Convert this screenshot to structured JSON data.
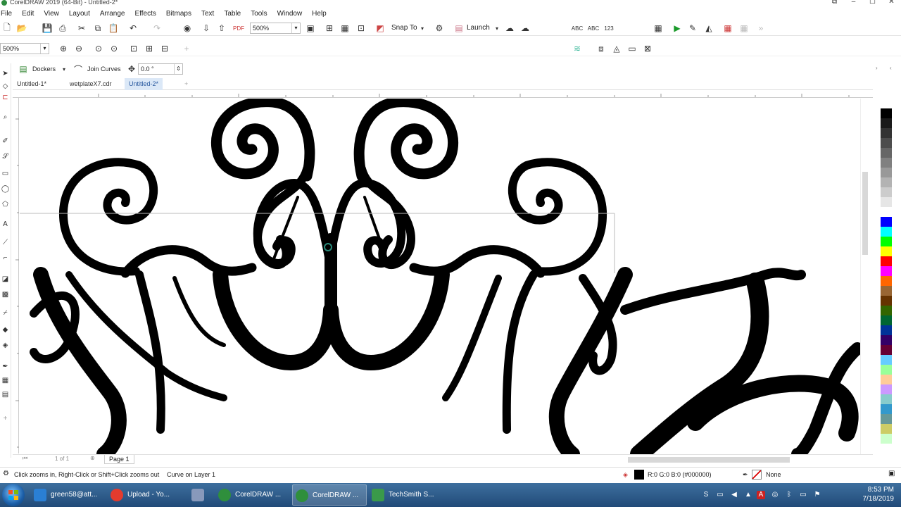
{
  "window": {
    "title": "CorelDRAW 2019 (64-Bit) - Untitled-2*"
  },
  "menu": [
    "File",
    "Edit",
    "View",
    "Layout",
    "Arrange",
    "Effects",
    "Bitmaps",
    "Text",
    "Table",
    "Tools",
    "Window",
    "Help"
  ],
  "toolbar": {
    "zoom_level": "500%",
    "snap_to": "Snap To",
    "launch": "Launch"
  },
  "toolbar2": {
    "zoom_level": "500%"
  },
  "property_bar": {
    "dockers": "Dockers",
    "join_curves": "Join Curves",
    "angle": "0.0 °"
  },
  "doc_tabs": [
    {
      "label": "Untitled-1*",
      "active": false
    },
    {
      "label": "wetplateX7.cdr",
      "active": false
    },
    {
      "label": "Untitled-2*",
      "active": true
    }
  ],
  "page_nav": {
    "page_label": "Page 1",
    "count": "1 of 1"
  },
  "status": {
    "hint": "Click zooms in, Right-Click or Shift+Click zooms out",
    "object": "Curve on Layer 1",
    "fill_color": "R:0 G:0 B:0 (#000000)",
    "outline": "None"
  },
  "palette_colors": [
    "#ffffff",
    "#000000",
    "#1a1a1a",
    "#333333",
    "#4d4d4d",
    "#666666",
    "#808080",
    "#999999",
    "#b3b3b3",
    "#cccccc",
    "#e6e6e6",
    "#ffffff",
    "#0000ff",
    "#00ffff",
    "#00ff00",
    "#ffff00",
    "#ff0000",
    "#ff00ff",
    "#ff6600",
    "#996633",
    "#663300",
    "#336600",
    "#006633",
    "#003399",
    "#330066",
    "#660033",
    "#66ccff",
    "#99ff99",
    "#ffcc99",
    "#cc99ff",
    "#88cccc",
    "#3399cc",
    "#669999",
    "#cccc66",
    "#ccffcc"
  ],
  "taskbar": {
    "items": [
      {
        "label": "green58@att...",
        "color": "#2a7fd4"
      },
      {
        "label": "Upload - Yo...",
        "color": "#e33b2e"
      },
      {
        "label": "",
        "color": "#8899bb"
      },
      {
        "label": "CorelDRAW ...",
        "color": "#2f8f3c"
      },
      {
        "label": "CorelDRAW ...",
        "color": "#2f8f3c"
      },
      {
        "label": "TechSmith S...",
        "color": "#3a9a4a"
      }
    ],
    "time": "8:53 PM",
    "date": "7/18/2019"
  }
}
